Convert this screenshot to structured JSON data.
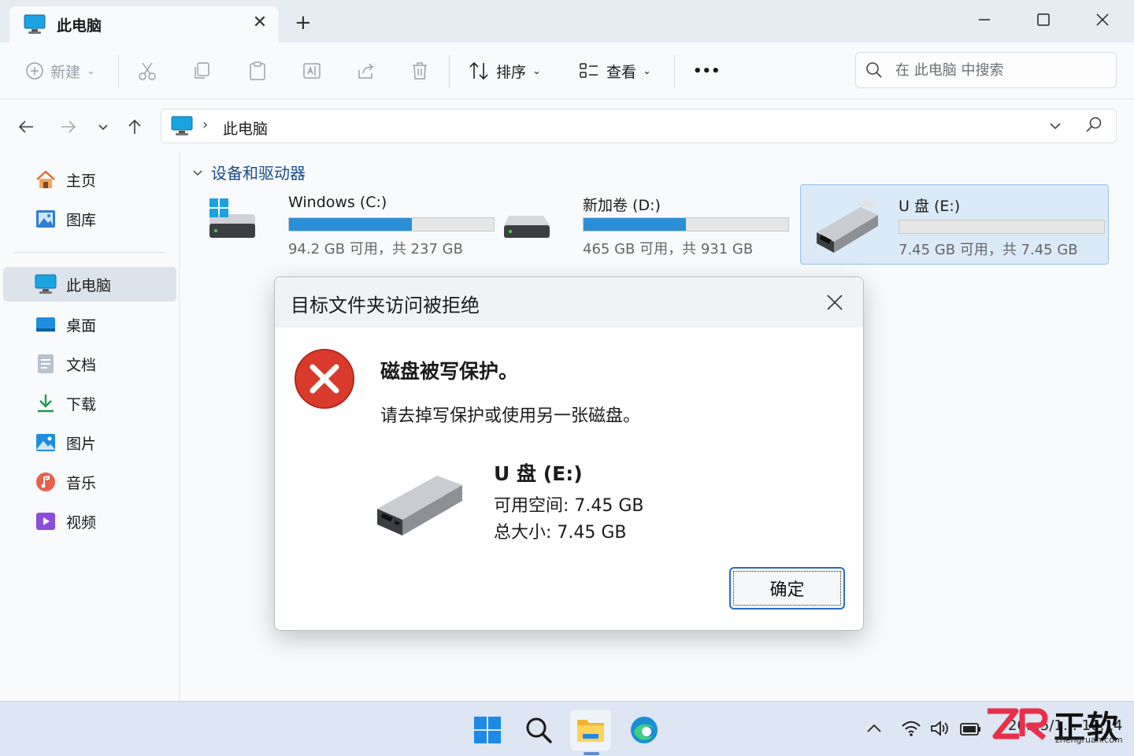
{
  "window": {
    "tab_title": "此电脑",
    "new_tab": "+"
  },
  "commandbar": {
    "new_label": "新建",
    "sort_label": "排序",
    "view_label": "查看",
    "more_label": "•••",
    "search_placeholder": "在 此电脑 中搜索"
  },
  "address": {
    "location": "此电脑"
  },
  "sidebar": {
    "items": [
      {
        "label": "主页"
      },
      {
        "label": "图库"
      },
      {
        "label": "此电脑"
      },
      {
        "label": "桌面"
      },
      {
        "label": "文档"
      },
      {
        "label": "下载"
      },
      {
        "label": "图片"
      },
      {
        "label": "音乐"
      },
      {
        "label": "视频"
      }
    ]
  },
  "main": {
    "section_title": "设备和驱动器",
    "drives": [
      {
        "name": "Windows (C:)",
        "free_text": "94.2 GB 可用，共 237 GB",
        "used_fraction": 0.6
      },
      {
        "name": "新加卷 (D:)",
        "free_text": "465 GB 可用，共 931 GB",
        "used_fraction": 0.5
      },
      {
        "name": "U 盘 (E:)",
        "free_text": "7.45 GB 可用，共 7.45 GB",
        "used_fraction": 0.0
      }
    ]
  },
  "dialog": {
    "title": "目标文件夹访问被拒绝",
    "heading": "磁盘被写保护。",
    "message": "请去掉写保护或使用另一张磁盘。",
    "drive_name": "U 盘 (E:)",
    "free_space": "可用空间: 7.45 GB",
    "total_size": "总大小: 7.45 GB",
    "ok_label": "确定"
  },
  "taskbar": {
    "clock": "20…5/1… 10:14"
  },
  "watermark": {
    "text": "正软",
    "url": "zhengruan.com"
  },
  "colors": {
    "accent": "#2b8fd8",
    "error": "#d93a2b",
    "section_heading": "#1a4e8a"
  }
}
